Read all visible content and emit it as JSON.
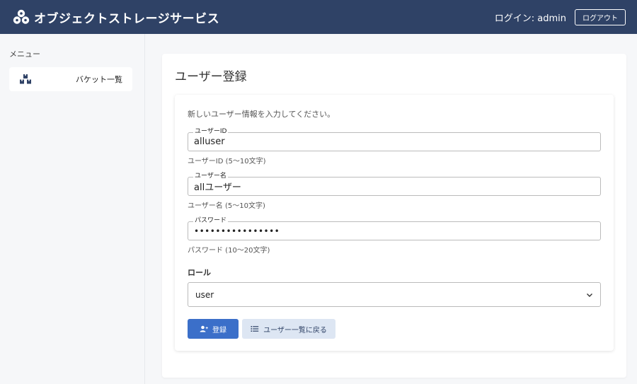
{
  "header": {
    "title": "オブジェクトストレージサービス",
    "login_text": "ログイン: admin",
    "logout_label": "ログアウト"
  },
  "sidebar": {
    "heading": "メニュー",
    "items": [
      {
        "label": "バケット一覧",
        "icon": "boxes-icon"
      }
    ]
  },
  "main": {
    "page_title": "ユーザー登録",
    "intro": "新しいユーザー情報を入力してください。",
    "fields": [
      {
        "label": "ユーザーID",
        "value": "alluser",
        "help": "ユーザーID (5〜10文字)"
      },
      {
        "label": "ユーザー名",
        "value": "allユーザー",
        "help": "ユーザー名 (5〜10文字)"
      },
      {
        "label": "パスワード",
        "value": "••••••••••••••••",
        "help": "パスワード (10〜20文字)"
      }
    ],
    "role": {
      "label": "ロール",
      "selected": "user"
    },
    "buttons": {
      "register": "登録",
      "back": "ユーザー一覧に戻る"
    }
  },
  "colors": {
    "header_bg": "#2f4266",
    "primary": "#3b6fc9",
    "secondary_bg": "#dde6f3"
  }
}
